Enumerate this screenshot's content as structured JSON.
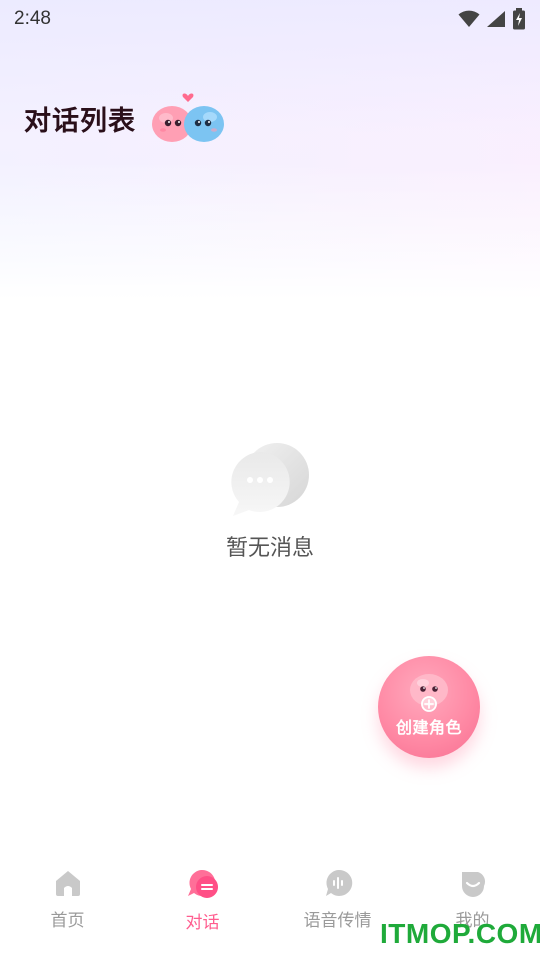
{
  "status_bar": {
    "time": "2:48",
    "icons": [
      "wifi-icon",
      "cellular-signal-icon",
      "battery-charging-icon"
    ]
  },
  "header": {
    "title": "对话列表",
    "mascot": "couple-mascot-icon"
  },
  "empty_state": {
    "icon": "chat-bubble-empty-icon",
    "text": "暂无消息"
  },
  "fab": {
    "label": "创建角色",
    "icon": "mascot-plus-icon",
    "color": "#ff8aa5"
  },
  "tabs": [
    {
      "label": "首页",
      "icon": "home-icon",
      "active": false
    },
    {
      "label": "对话",
      "icon": "chat-icon",
      "active": true
    },
    {
      "label": "语音传情",
      "icon": "voice-icon",
      "active": false
    },
    {
      "label": "我的",
      "icon": "profile-icon",
      "active": false
    }
  ],
  "accent_color": "#ff5d8f",
  "watermark": "ITMOP.COM"
}
